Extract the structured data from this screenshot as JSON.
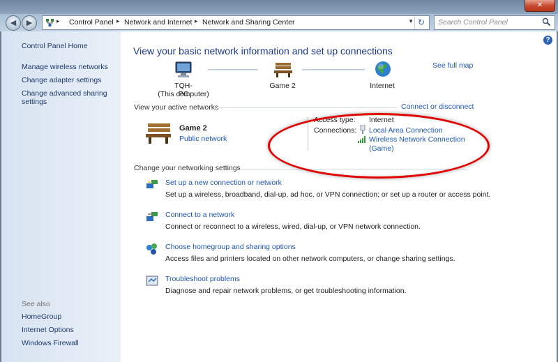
{
  "breadcrumb": {
    "items": [
      "Control Panel",
      "Network and Internet",
      "Network and Sharing Center"
    ]
  },
  "search": {
    "placeholder": "Search Control Panel"
  },
  "sidebar": {
    "home": "Control Panel Home",
    "links": [
      "Manage wireless networks",
      "Change adapter settings",
      "Change advanced sharing settings"
    ],
    "see_also_heading": "See also",
    "see_also": [
      "HomeGroup",
      "Internet Options",
      "Windows Firewall"
    ]
  },
  "main": {
    "title": "View your basic network information and set up connections",
    "see_full_map": "See full map",
    "map": {
      "computer_name": "TQH-PC",
      "computer_sub": "(This computer)",
      "network_name": "Game  2",
      "internet": "Internet"
    },
    "active_heading": "View your active networks",
    "connect_disconnect": "Connect or disconnect",
    "active_network": {
      "name": "Game  2",
      "category": "Public network",
      "access_type_label": "Access type:",
      "access_type_value": "Internet",
      "connections_label": "Connections:",
      "connection_1": "Local Area Connection",
      "connection_2": "Wireless Network Connection",
      "connection_2_sub": "(Game)"
    },
    "settings_heading": "Change your networking settings",
    "tasks": [
      {
        "title": "Set up a new connection or network",
        "desc": "Set up a wireless, broadband, dial-up, ad hoc, or VPN connection; or set up a router or access point."
      },
      {
        "title": "Connect to a network",
        "desc": "Connect or reconnect to a wireless, wired, dial-up, or VPN network connection."
      },
      {
        "title": "Choose homegroup and sharing options",
        "desc": "Access files and printers located on other network computers, or change sharing settings."
      },
      {
        "title": "Troubleshoot problems",
        "desc": "Diagnose and repair network problems, or get troubleshooting information."
      }
    ]
  },
  "colors": {
    "link": "#1c56b8",
    "title": "#1e3a8a",
    "highlight": "#e00000",
    "sidebar": "#dfe8f3"
  }
}
